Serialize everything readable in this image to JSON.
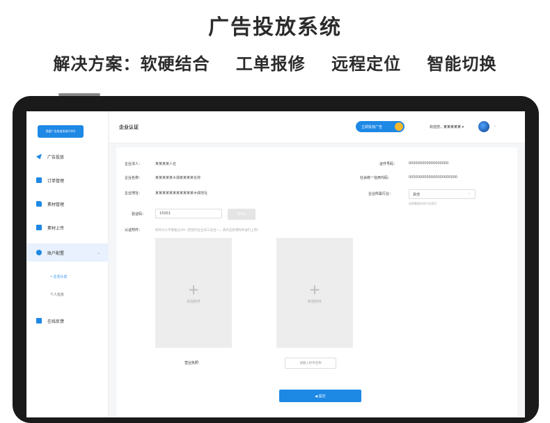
{
  "hero": {
    "title": "广告投放系统",
    "subtitle_items": [
      "解决方案：软硬结合",
      "工单报修",
      "远程定位",
      "智能切换"
    ]
  },
  "sidebar": {
    "top_button": "我要广告投放系统(100)",
    "items": [
      {
        "label": "广告投放",
        "icon": "send-icon",
        "color": "#1e88e5"
      },
      {
        "label": "订单管理",
        "icon": "order-icon",
        "color": "#1e88e5"
      },
      {
        "label": "素材管理",
        "icon": "folder-icon",
        "color": "#1e88e5"
      },
      {
        "label": "素材上传",
        "icon": "upload-icon",
        "color": "#1e88e5"
      },
      {
        "label": "账户配置",
        "icon": "gear-icon",
        "color": "#1e88e5",
        "active": true
      },
      {
        "label": "在线反馈",
        "icon": "feedback-icon",
        "color": "#1e88e5"
      }
    ],
    "subitems": [
      "• 企业认证",
      "个人信息"
    ]
  },
  "topbar": {
    "title": "企业认证",
    "pill": "立即投放广告",
    "welcome": "欢迎您，某某某某某 ▾",
    "chevron": "⌄"
  },
  "form": {
    "legal_label": "企业法人：",
    "legal_value": "某某某某人名",
    "name_label": "企业名称：",
    "name_value": "某某某某某木偶某某某某名称",
    "addr_label": "企业地址：",
    "addr_value": "某某某某某某某某某某某木偶地址",
    "cert_label": "证件号码：",
    "cert_value": "000000000000000000",
    "credit_label": "社会统一信用代码：",
    "credit_value": "0000000000000000000000",
    "industry_label": "企业所属行业：",
    "industry_value": "其他",
    "industry_hint": "选择最接近的行业类目",
    "code_label": "验证码：",
    "code_value": "15001",
    "code_button": "[50s]",
    "attach_label": "认证附件：",
    "attach_hint": "附件大小不要超过2M（若您的企业未三证合一，请点击新增附件进行上传）",
    "upload1_text": "添加附件",
    "upload2_text": "新增附件",
    "caption1": "营业执照",
    "caption2_placeholder": "请输入附件名称",
    "submit": "◀ 提交"
  }
}
